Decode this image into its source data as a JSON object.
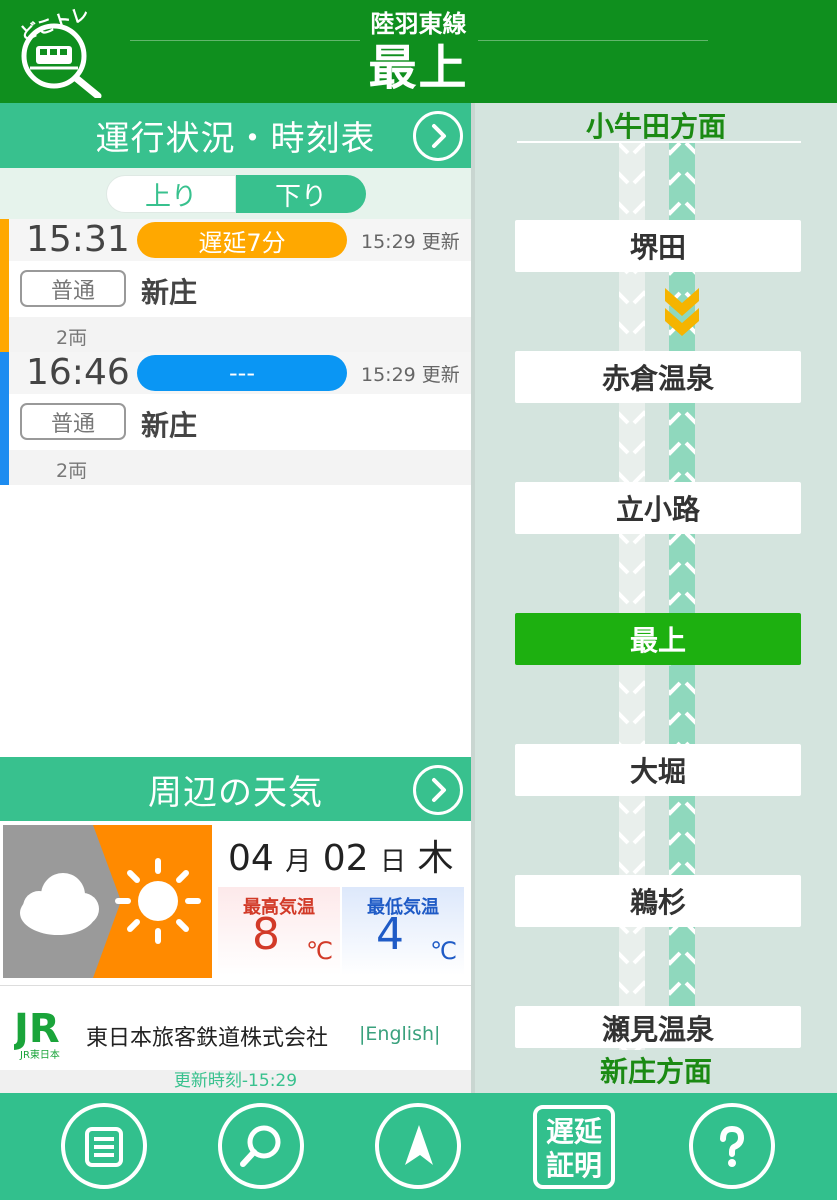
{
  "header": {
    "line_name": "陸羽東線",
    "station_name": "最上",
    "logo_text": "どこトレ"
  },
  "timetable": {
    "title": "運行状況・時刻表",
    "tab_up": "上り",
    "tab_down": "下り",
    "trains": [
      {
        "time": "15:31",
        "status": "遅延7分",
        "status_color": "#ffa800",
        "bar_color": "#ffa800",
        "updated": "15:29 更新",
        "type": "普通",
        "destination": "新庄",
        "cars": "2両"
      },
      {
        "time": "16:46",
        "status": "---",
        "status_color": "#0a96f4",
        "bar_color": "#1d8cf0",
        "updated": "15:29 更新",
        "type": "普通",
        "destination": "新庄",
        "cars": "2両"
      }
    ]
  },
  "weather": {
    "title": "周辺の天気",
    "icons": [
      "cloud-icon",
      "sun-icon"
    ],
    "month": "04",
    "month_unit": "月",
    "day": "02",
    "day_unit": "日",
    "weekday": "木",
    "high_label": "最高気温",
    "high_value": "8",
    "low_label": "最低気温",
    "low_value": "4",
    "unit": "℃"
  },
  "company": {
    "logo_text": "JR",
    "logo_sub": "JR東日本",
    "name": "東日本旅客鉄道株式会社",
    "english_link": "|English|"
  },
  "updated_time": "更新時刻-15:29",
  "route": {
    "direction_top": "小牛田方面",
    "direction_bottom": "新庄方面",
    "stations": [
      "堺田",
      "赤倉温泉",
      "立小路",
      "最上",
      "大堀",
      "鵜杉",
      "瀬見温泉"
    ],
    "current_station": "最上"
  },
  "footer": {
    "buttons": [
      "menu-icon",
      "search-icon",
      "navigate-icon",
      "delay-certificate",
      "help-icon"
    ],
    "delay_cert_line1": "遅延",
    "delay_cert_line2": "証明"
  },
  "colors": {
    "header_green": "#0f8f1e",
    "accent_green": "#38c18e",
    "current_station": "#1db010",
    "delay_orange": "#ffa800",
    "ontime_blue": "#0a96f4"
  }
}
